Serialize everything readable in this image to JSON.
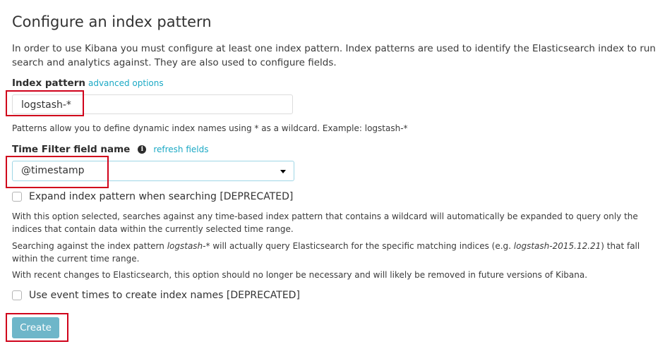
{
  "page": {
    "title": "Configure an index pattern",
    "intro": "In order to use Kibana you must configure at least one index pattern. Index patterns are used to identify the Elasticsearch index to run search and analytics against. They are also used to configure fields."
  },
  "index_pattern": {
    "label": "Index pattern",
    "link": "advanced options",
    "value": "logstash-*",
    "help": "Patterns allow you to define dynamic index names using * as a wildcard. Example: logstash-*"
  },
  "time_filter": {
    "label": "Time Filter field name",
    "info_icon": "info-icon",
    "link": "refresh fields",
    "selected": "@timestamp"
  },
  "expand_option": {
    "label": "Expand index pattern when searching [DEPRECATED]",
    "checked": false,
    "desc1": "With this option selected, searches against any time-based index pattern that contains a wildcard will automatically be expanded to query only the indices that contain data within the currently selected time range.",
    "desc2_pre": "Searching against the index pattern ",
    "desc2_pattern": "logstash-*",
    "desc2_mid": " will actually query Elasticsearch for the specific matching indices (e.g. ",
    "desc2_example": "logstash-2015.12.21",
    "desc2_post": ") that fall within the current time range.",
    "desc3": "With recent changes to Elasticsearch, this option should no longer be necessary and will likely be removed in future versions of Kibana."
  },
  "event_times_option": {
    "label": "Use event times to create index names [DEPRECATED]",
    "checked": false
  },
  "actions": {
    "create_label": "Create"
  },
  "colors": {
    "accent_link": "#1ba9c5",
    "button": "#6eb6c9",
    "annotation": "#d0021b"
  }
}
